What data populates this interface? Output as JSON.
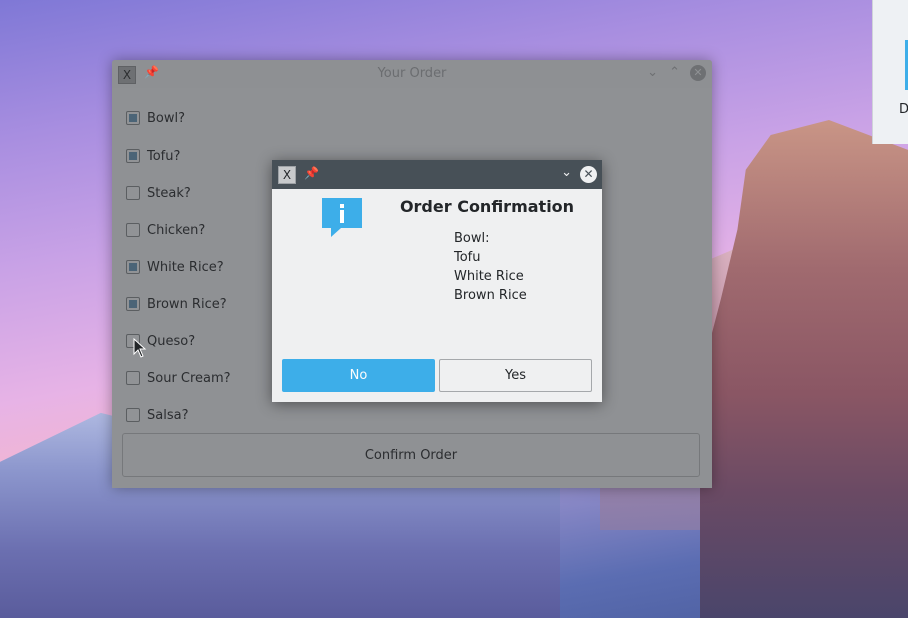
{
  "desktop": {
    "icon_label": "D"
  },
  "main_window": {
    "title": "Your Order",
    "options": [
      {
        "label": "Bowl?",
        "checked": true
      },
      {
        "label": "Tofu?",
        "checked": true
      },
      {
        "label": "Steak?",
        "checked": false
      },
      {
        "label": "Chicken?",
        "checked": false
      },
      {
        "label": "White Rice?",
        "checked": true
      },
      {
        "label": "Brown Rice?",
        "checked": true
      },
      {
        "label": "Queso?",
        "checked": false
      },
      {
        "label": "Sour Cream?",
        "checked": false
      },
      {
        "label": "Salsa?",
        "checked": false
      }
    ],
    "confirm_label": "Confirm Order"
  },
  "dialog": {
    "heading": "Order Confirmation",
    "lines": [
      "Bowl:",
      "Tofu",
      "White Rice",
      "Brown Rice"
    ],
    "no_label": "No",
    "yes_label": "Yes"
  },
  "colors": {
    "accent": "#3daee9",
    "dialog_titlebar": "#475057"
  }
}
